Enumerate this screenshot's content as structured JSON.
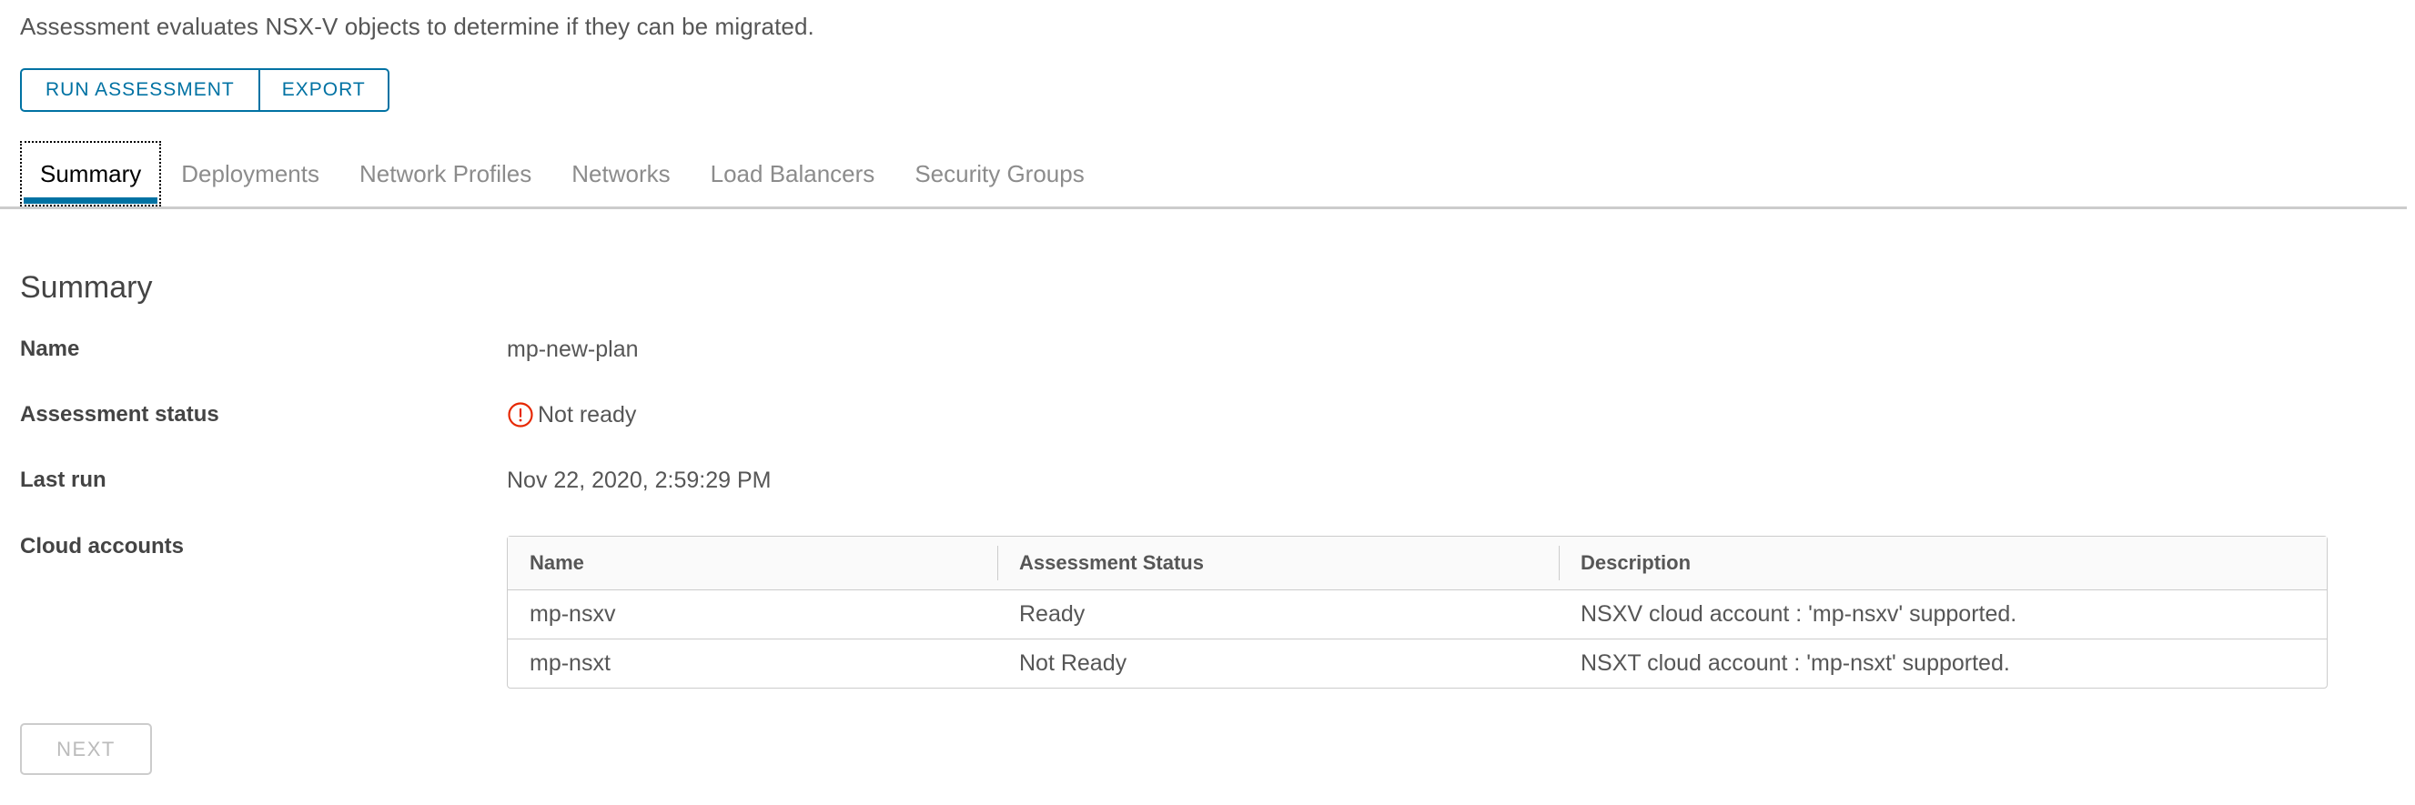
{
  "intro": {
    "text": "Assessment evaluates NSX-V objects to determine if they can be migrated."
  },
  "toolbar": {
    "run_assessment_label": "RUN ASSESSMENT",
    "export_label": "EXPORT"
  },
  "tabs": [
    {
      "label": "Summary",
      "active": true
    },
    {
      "label": "Deployments",
      "active": false
    },
    {
      "label": "Network Profiles",
      "active": false
    },
    {
      "label": "Networks",
      "active": false
    },
    {
      "label": "Load Balancers",
      "active": false
    },
    {
      "label": "Security Groups",
      "active": false
    }
  ],
  "summary": {
    "heading": "Summary",
    "name_label": "Name",
    "name_value": "mp-new-plan",
    "status_label": "Assessment status",
    "status_value": "Not ready",
    "status_icon": "error-exclamation-circle-icon",
    "status_color": "#e62700",
    "lastrun_label": "Last run",
    "lastrun_value": "Nov 22, 2020, 2:59:29 PM",
    "cloud_accounts_label": "Cloud accounts"
  },
  "cloud_accounts_table": {
    "columns": [
      "Name",
      "Assessment Status",
      "Description"
    ],
    "rows": [
      {
        "name": "mp-nsxv",
        "status": "Ready",
        "description": "NSXV cloud account : 'mp-nsxv' supported."
      },
      {
        "name": "mp-nsxt",
        "status": "Not Ready",
        "description": "NSXT cloud account : 'mp-nsxt' supported."
      }
    ]
  },
  "footer": {
    "next_label": "NEXT",
    "next_disabled": true
  },
  "colors": {
    "accent": "#0072a3",
    "danger": "#e62700",
    "text": "#565656",
    "label": "#444444",
    "muted": "#8c8c8c",
    "border": "#cccccc",
    "header_bg": "#fafafa"
  }
}
